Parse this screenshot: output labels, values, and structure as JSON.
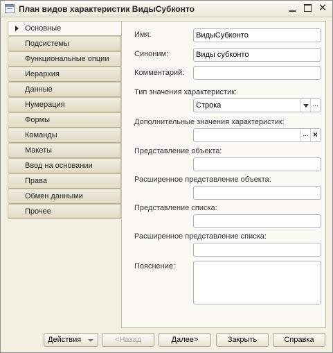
{
  "window": {
    "title": "План видов характеристик ВидыСубконто"
  },
  "tabs": [
    {
      "label": "Основные",
      "active": true
    },
    {
      "label": "Подсистемы"
    },
    {
      "label": "Функциональные опции"
    },
    {
      "label": "Иерархия"
    },
    {
      "label": "Данные"
    },
    {
      "label": "Нумерация"
    },
    {
      "label": "Формы"
    },
    {
      "label": "Команды"
    },
    {
      "label": "Макеты"
    },
    {
      "label": "Ввод на основании"
    },
    {
      "label": "Права"
    },
    {
      "label": "Обмен данными"
    },
    {
      "label": "Прочее"
    }
  ],
  "form": {
    "name_label": "Имя:",
    "name_value": "ВидыСубконто",
    "synonym_label": "Синоним:",
    "synonym_value": "Виды субконто",
    "comment_label": "Комментарий:",
    "comment_value": "",
    "value_type_label": "Тип значения характеристик:",
    "value_type_value": "Строка",
    "extra_values_label": "Дополнительные значения характеристик:",
    "extra_values_value": "",
    "object_repr_label": "Представление объекта:",
    "object_repr_value": "",
    "ext_object_repr_label": "Расширенное представление объекта:",
    "ext_object_repr_value": "",
    "list_repr_label": "Представление списка:",
    "list_repr_value": "",
    "ext_list_repr_label": "Расширенное представление списка:",
    "ext_list_repr_value": "",
    "explanation_label": "Пояснение:",
    "explanation_value": "",
    "ellipsis": "...",
    "clear": "×"
  },
  "buttons": {
    "actions": "Действия",
    "back": "<Назад",
    "next": "Далее>",
    "close": "Закрыть",
    "help": "Справка"
  },
  "icons": {
    "window": "window-icon",
    "minimize": "minimize-icon",
    "maximize": "maximize-icon",
    "close": "close-icon",
    "dropdown": "chevron-down-icon",
    "clear": "clear-icon",
    "tab_marker": "triangle-right-icon"
  }
}
